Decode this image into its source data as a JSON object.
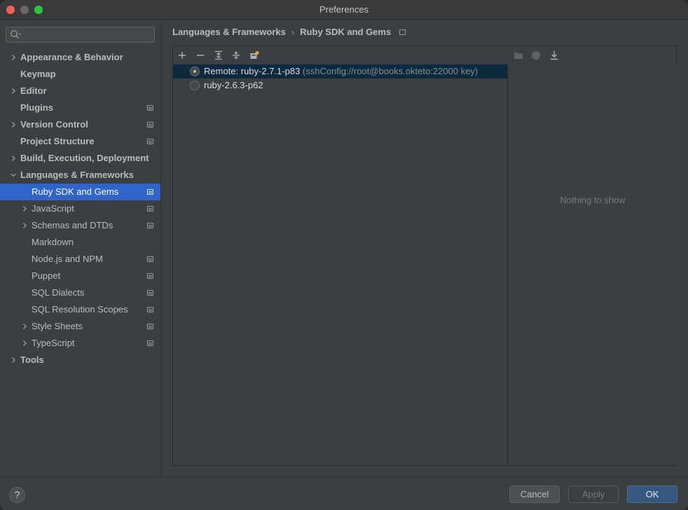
{
  "window": {
    "title": "Preferences"
  },
  "search": {
    "placeholder": "",
    "value": ""
  },
  "sidebar": {
    "items": [
      {
        "label": "Appearance & Behavior",
        "level": 0,
        "expandable": true,
        "expanded": false,
        "bold": true,
        "badge": false
      },
      {
        "label": "Keymap",
        "level": 0,
        "expandable": false,
        "bold": true,
        "badge": false
      },
      {
        "label": "Editor",
        "level": 0,
        "expandable": true,
        "expanded": false,
        "bold": true,
        "badge": false
      },
      {
        "label": "Plugins",
        "level": 0,
        "expandable": false,
        "bold": true,
        "badge": true
      },
      {
        "label": "Version Control",
        "level": 0,
        "expandable": true,
        "expanded": false,
        "bold": true,
        "badge": true
      },
      {
        "label": "Project Structure",
        "level": 0,
        "expandable": false,
        "bold": true,
        "badge": true
      },
      {
        "label": "Build, Execution, Deployment",
        "level": 0,
        "expandable": true,
        "expanded": false,
        "bold": true,
        "badge": false
      },
      {
        "label": "Languages & Frameworks",
        "level": 0,
        "expandable": true,
        "expanded": true,
        "bold": true,
        "badge": false
      },
      {
        "label": "Ruby SDK and Gems",
        "level": 1,
        "expandable": false,
        "bold": false,
        "badge": true,
        "selected": true
      },
      {
        "label": "JavaScript",
        "level": 1,
        "expandable": true,
        "expanded": false,
        "bold": false,
        "badge": true
      },
      {
        "label": "Schemas and DTDs",
        "level": 1,
        "expandable": true,
        "expanded": false,
        "bold": false,
        "badge": true
      },
      {
        "label": "Markdown",
        "level": 1,
        "expandable": false,
        "bold": false,
        "badge": false
      },
      {
        "label": "Node.js and NPM",
        "level": 1,
        "expandable": false,
        "bold": false,
        "badge": true
      },
      {
        "label": "Puppet",
        "level": 1,
        "expandable": false,
        "bold": false,
        "badge": true
      },
      {
        "label": "SQL Dialects",
        "level": 1,
        "expandable": false,
        "bold": false,
        "badge": true
      },
      {
        "label": "SQL Resolution Scopes",
        "level": 1,
        "expandable": false,
        "bold": false,
        "badge": true
      },
      {
        "label": "Style Sheets",
        "level": 1,
        "expandable": true,
        "expanded": false,
        "bold": false,
        "badge": true
      },
      {
        "label": "TypeScript",
        "level": 1,
        "expandable": true,
        "expanded": false,
        "bold": false,
        "badge": true
      },
      {
        "label": "Tools",
        "level": 0,
        "expandable": true,
        "expanded": false,
        "bold": true,
        "badge": false
      }
    ]
  },
  "breadcrumb": {
    "parent": "Languages & Frameworks",
    "current": "Ruby SDK and Gems"
  },
  "toolbar": {
    "icons": [
      "add-icon",
      "remove-icon",
      "expand-all-icon",
      "collapse-all-icon",
      "sdk-settings-icon"
    ]
  },
  "sdks": [
    {
      "name": "Remote: ruby-2.7.1-p83",
      "detail": "(sshConfig://root@books.okteto:22000 key)",
      "selected": true
    },
    {
      "name": "ruby-2.6.3-p62",
      "detail": "",
      "selected": false
    }
  ],
  "gems_panel": {
    "icons": [
      "folder-icon",
      "circle-icon",
      "download-icon"
    ],
    "empty_text": "Nothing to show"
  },
  "footer": {
    "help_label": "?",
    "cancel_label": "Cancel",
    "apply_label": "Apply",
    "ok_label": "OK"
  },
  "colors": {
    "selection": "#2f65ca",
    "list_selection": "#0d293e",
    "ok_button": "#365880"
  }
}
